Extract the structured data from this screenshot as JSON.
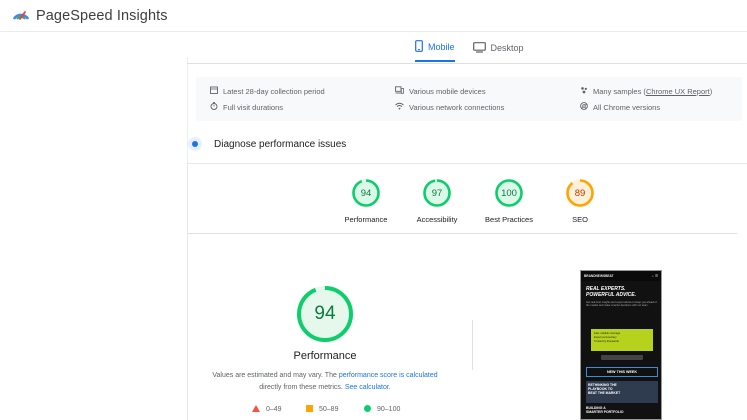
{
  "app": {
    "title": "PageSpeed Insights"
  },
  "tabs": [
    {
      "label": "Mobile",
      "active": true
    },
    {
      "label": "Desktop",
      "active": false
    }
  ],
  "crux": {
    "col1": [
      "Latest 28-day collection period",
      "Full visit durations"
    ],
    "col2": [
      "Various mobile devices",
      "Various network connections"
    ],
    "col3_prefix": "Many samples (",
    "col3_link": "Chrome UX Report",
    "col3_suffix": ")",
    "col3_line2": "All Chrome versions"
  },
  "diagnose": {
    "title": "Diagnose performance issues"
  },
  "scores": [
    {
      "label": "Performance",
      "value": "94",
      "fraction": 0.94,
      "color": "#0cce6b",
      "text_color": "#0c7a3f"
    },
    {
      "label": "Accessibility",
      "value": "97",
      "fraction": 0.97,
      "color": "#0cce6b",
      "text_color": "#0c7a3f"
    },
    {
      "label": "Best Practices",
      "value": "100",
      "fraction": 1.0,
      "color": "#0cce6b",
      "text_color": "#0c7a3f"
    },
    {
      "label": "SEO",
      "value": "89",
      "fraction": 0.89,
      "color": "#ffa400",
      "text_color": "#c33300"
    }
  ],
  "main_score": {
    "value": "94",
    "fraction": 0.94,
    "label": "Performance"
  },
  "note": {
    "part1": "Values are estimated and may vary. The ",
    "link1": "performance score is calculated",
    "part2": "directly from these metrics. ",
    "link2": "See calculator."
  },
  "legend": [
    {
      "range": "0–49",
      "color": "#ff4e42",
      "shape": "triangle"
    },
    {
      "range": "50–89",
      "color": "#ffa400",
      "shape": "square"
    },
    {
      "range": "90–100",
      "color": "#0cce6b",
      "shape": "circle"
    }
  ],
  "screenshot": {
    "brand": "BRANDNEWSBEAT",
    "headline1": "REAL EXPERTS.",
    "headline2": "POWERFUL ADVICE.",
    "body": "Get real-time insights and expert advice to keep you ahead of the market and make smarter decisions with our team.",
    "green_lines": [
      "Fast, reliable coverage",
      "Expert commentary",
      "Trusted by thousands"
    ],
    "bar": "NEW THIS WEEK",
    "thumb_lines": [
      "RETHINKING THE",
      "PLAYBOOK TO",
      "BEAT THE MARKET"
    ],
    "foot_lines": [
      "BUILDING A",
      "SMARTER PORTFOLIO"
    ]
  }
}
